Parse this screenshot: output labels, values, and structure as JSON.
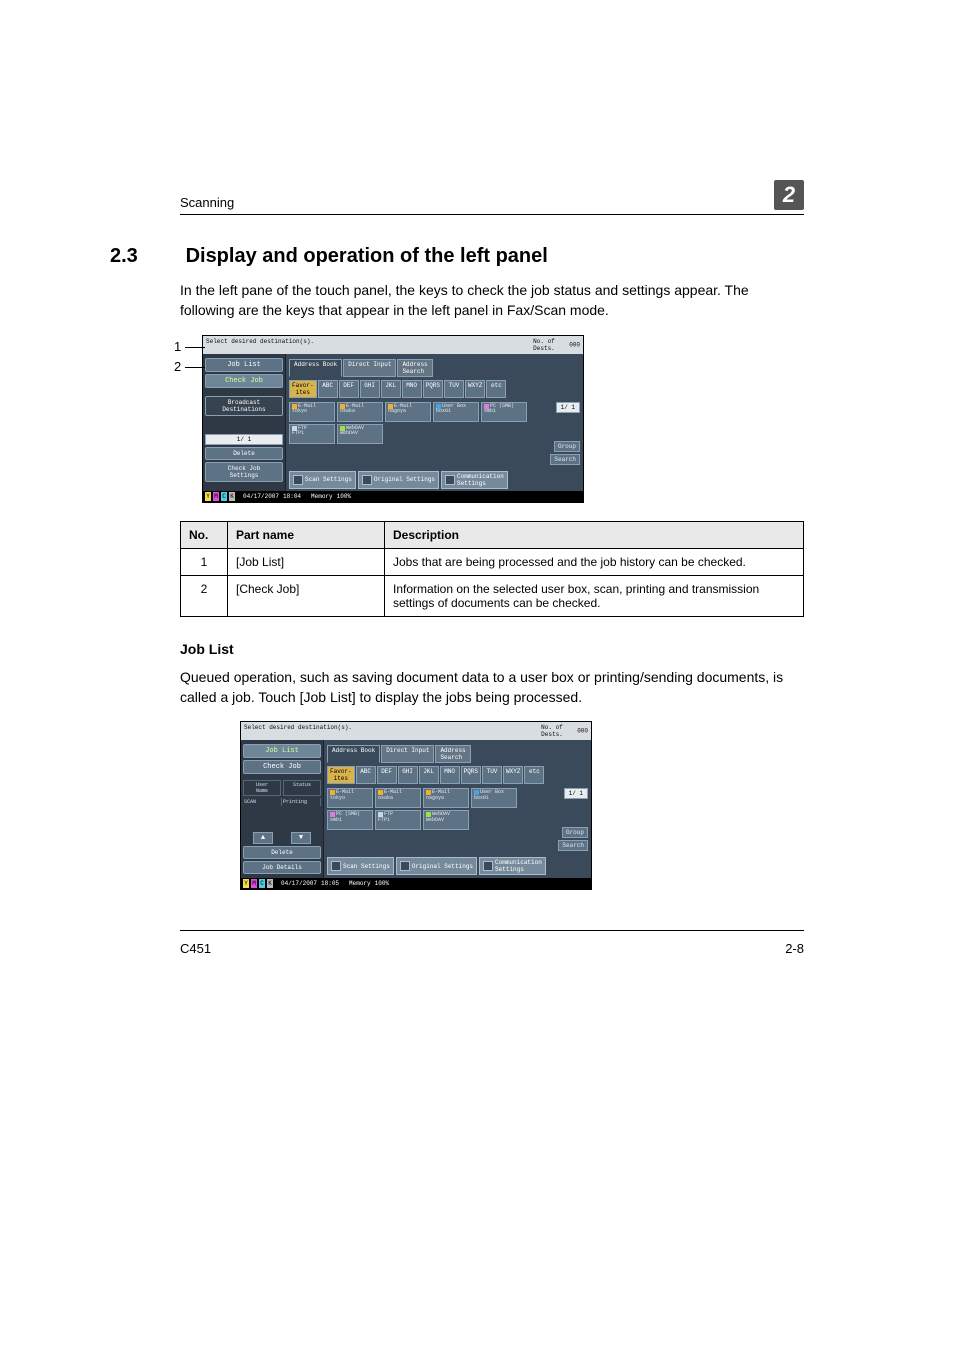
{
  "header": {
    "chapter_name": "Scanning",
    "chapter_number": "2"
  },
  "section": {
    "number": "2.3",
    "title": "Display and operation of the left panel",
    "intro": "In the left pane of the touch panel, the keys to check the job status and settings appear. The following are the keys that appear in the left panel in Fax/Scan mode."
  },
  "callouts": {
    "one": "1",
    "two": "2"
  },
  "parts_table": {
    "head": {
      "no": "No.",
      "part": "Part name",
      "desc": "Description"
    },
    "rows": [
      {
        "no": "1",
        "part": "[Job List]",
        "desc": "Jobs that are being processed and the job history can be checked."
      },
      {
        "no": "2",
        "part": "[Check Job]",
        "desc": "Information on the selected user box, scan, printing and transmission settings of documents can be checked."
      }
    ]
  },
  "job_list": {
    "heading": "Job List",
    "text": "Queued operation, such as saving document data to a user box or printing/sending documents, is called a job. Touch [Job List] to display the jobs being processed."
  },
  "footer": {
    "model": "C451",
    "page": "2-8"
  },
  "mfp1": {
    "left": {
      "job_list": "Job List",
      "check_job": "Check Job",
      "bcast": "Broadcast\nDestinations",
      "page": "1/  1",
      "delete": "Delete",
      "chk_set": "Check Job\nSettings"
    },
    "top": {
      "prompt": "Select desired destination(s).",
      "dests_label": "No. of\nDests.",
      "dests_count": "000"
    },
    "tabs": {
      "book": "Address Book",
      "direct": "Direct Input",
      "search": "Address\nSearch"
    },
    "alpha": [
      "Favor-\nites",
      "ABC",
      "DEF",
      "GHI",
      "JKL",
      "MNO",
      "PQRS",
      "TUV",
      "WXYZ",
      "etc"
    ],
    "dests": [
      {
        "ico": "mail",
        "l1": "E-Mail",
        "l2": "tokyo"
      },
      {
        "ico": "mail",
        "l1": "E-Mail",
        "l2": "osaka"
      },
      {
        "ico": "mail",
        "l1": "E-Mail",
        "l2": "nagoya"
      },
      {
        "ico": "box",
        "l1": "User Box",
        "l2": "box01"
      },
      {
        "ico": "smb",
        "l1": "PC (SMB)",
        "l2": "smb1"
      },
      {
        "ico": "ftp",
        "l1": "FTP",
        "l2": "FTP1"
      },
      {
        "ico": "dav",
        "l1": "WebDAV",
        "l2": "WebDAV"
      }
    ],
    "page_ind": "1/  1",
    "group": "Group",
    "search": "Search",
    "bottom": {
      "scan": "Scan Settings",
      "orig": "Original Settings",
      "comm": "Communication\nSettings"
    },
    "status": {
      "date": "04/17/2007",
      "time": "18:04",
      "mem": "Memory",
      "pct": "100%"
    }
  },
  "mfp2": {
    "left": {
      "job_list": "Job List",
      "check_job": "Check Job",
      "hdr1": "User\nName",
      "hdr2": "Status",
      "c1": "SCAN",
      "c2": "Printing",
      "delete": "Delete",
      "details": "Job Details"
    },
    "top": {
      "prompt": "Select desired destination(s).",
      "dests_label": "No. of\nDests.",
      "dests_count": "000"
    },
    "tabs": {
      "book": "Address Book",
      "direct": "Direct Input",
      "search": "Address\nSearch"
    },
    "alpha": [
      "Favor-\nites",
      "ABC",
      "DEF",
      "GHI",
      "JKL",
      "MNO",
      "PQRS",
      "TUV",
      "WXYZ",
      "etc"
    ],
    "dests": [
      {
        "ico": "mail",
        "l1": "E-Mail",
        "l2": "tokyo"
      },
      {
        "ico": "mail",
        "l1": "E-Mail",
        "l2": "osaka"
      },
      {
        "ico": "mail",
        "l1": "E-Mail",
        "l2": "nagoya"
      },
      {
        "ico": "box",
        "l1": "User Box",
        "l2": "box01"
      },
      {
        "ico": "smb",
        "l1": "PC (SMB)",
        "l2": "smb1"
      },
      {
        "ico": "ftp",
        "l1": "FTP",
        "l2": "FTP1"
      },
      {
        "ico": "dav",
        "l1": "WebDAV",
        "l2": "WebDAV"
      }
    ],
    "page_ind": "1/  1",
    "group": "Group",
    "search": "Search",
    "bottom": {
      "scan": "Scan Settings",
      "orig": "Original Settings",
      "comm": "Communication\nSettings"
    },
    "status": {
      "date": "04/17/2007",
      "time": "18:05",
      "mem": "Memory",
      "pct": "100%"
    }
  }
}
